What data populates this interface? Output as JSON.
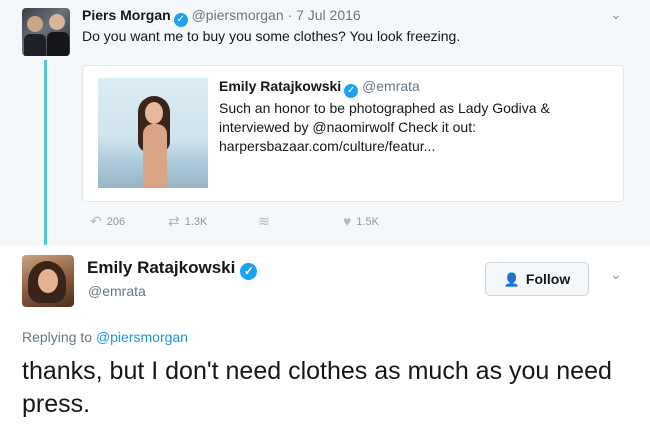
{
  "original_tweet": {
    "name": "Piers Morgan",
    "handle": "@piersmorgan",
    "separator": "·",
    "date": "7 Jul 2016",
    "text": "Do you want me to buy you some clothes? You look freezing.",
    "quoted": {
      "name": "Emily Ratajkowski",
      "handle": "@emrata",
      "text": "Such an honor to be photographed as Lady Godiva & interviewed by @naomirwolf Check it out: harpersbazaar.com/culture/featur..."
    },
    "actions": {
      "replies": "206",
      "retweets": "1.3K",
      "likes": "1.5K"
    }
  },
  "reply_tweet": {
    "name": "Emily Ratajkowski",
    "handle": "@emrata",
    "follow_label": "Follow",
    "replying_prefix": "Replying to",
    "replying_handle": "@piersmorgan",
    "text": "thanks, but I don't need clothes as much as you need press."
  },
  "icons": [
    "verified-icon",
    "reply-icon",
    "retweet-icon",
    "stack-icon",
    "heart-icon",
    "add-user-icon",
    "chevron-down-icon"
  ],
  "colors": {
    "accent": "#1da1f2",
    "link": "#1b95e0",
    "thread": "#55c5d1",
    "muted": "#657786"
  }
}
